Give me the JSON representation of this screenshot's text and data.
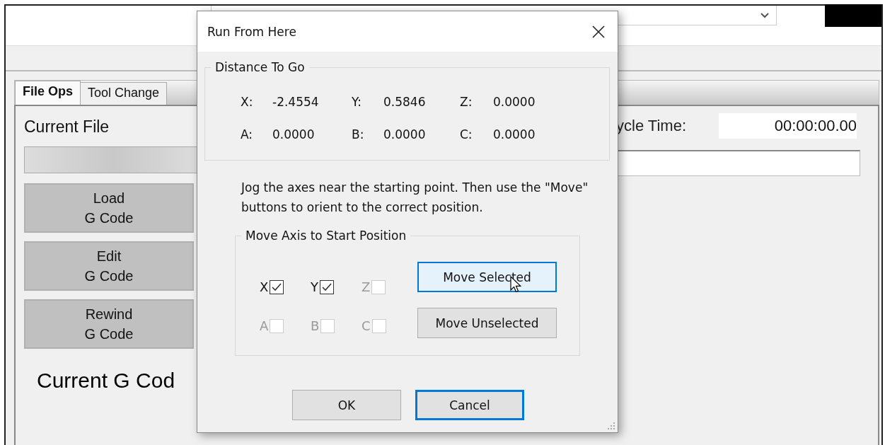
{
  "main_window": {
    "tabs": [
      {
        "label": "File Ops",
        "selected": true
      },
      {
        "label": "Tool Change",
        "selected": false
      }
    ],
    "current_file_label": "Current File",
    "file_buttons": [
      {
        "line1": "Load",
        "line2": "G Code"
      },
      {
        "line1": "Edit",
        "line2": "G Code"
      },
      {
        "line1": "Rewind",
        "line2": "G Code"
      }
    ],
    "current_gcode_label": "Current G Cod",
    "cycle_time_label": "ycle Time:",
    "cycle_time_value": "00:00:00.00"
  },
  "dialog": {
    "title": "Run From Here",
    "distance_group": {
      "title": "Distance To Go",
      "axes": [
        {
          "label": "X:",
          "value": "-2.4554"
        },
        {
          "label": "Y:",
          "value": "0.5846"
        },
        {
          "label": "Z:",
          "value": "0.0000"
        },
        {
          "label": "A:",
          "value": "0.0000"
        },
        {
          "label": "B:",
          "value": "0.0000"
        },
        {
          "label": "C:",
          "value": "0.0000"
        }
      ]
    },
    "instructions": "Jog the axes near the starting point.  Then use the \"Move\" buttons to orient to the correct position.",
    "move_group": {
      "title": "Move Axis to Start Position",
      "checkboxes": [
        {
          "label": "X",
          "checked": true,
          "disabled": false
        },
        {
          "label": "Y",
          "checked": true,
          "disabled": false
        },
        {
          "label": "Z",
          "checked": false,
          "disabled": true
        },
        {
          "label": "A",
          "checked": false,
          "disabled": true
        },
        {
          "label": "B",
          "checked": false,
          "disabled": true
        },
        {
          "label": "C",
          "checked": false,
          "disabled": true
        }
      ],
      "buttons": [
        {
          "label": "Move Selected",
          "hovered": true
        },
        {
          "label": "Move Unselected",
          "hovered": false
        }
      ]
    },
    "buttons": [
      {
        "label": "OK",
        "default": false
      },
      {
        "label": "Cancel",
        "default": true
      }
    ]
  }
}
